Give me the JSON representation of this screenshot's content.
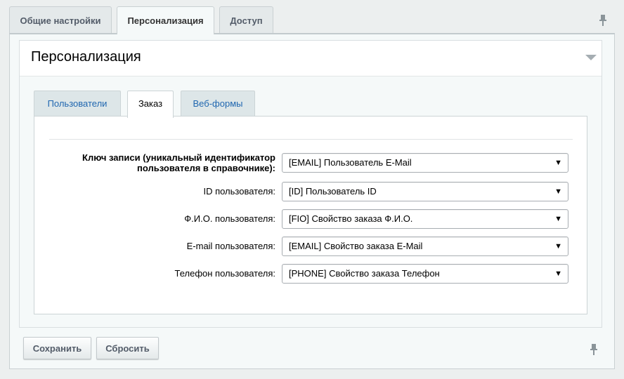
{
  "top_tabs": [
    {
      "label": "Общие настройки",
      "active": false
    },
    {
      "label": "Персонализация",
      "active": true
    },
    {
      "label": "Доступ",
      "active": false
    }
  ],
  "section": {
    "title": "Персонализация"
  },
  "inner_tabs": [
    {
      "label": "Пользователи",
      "active": false
    },
    {
      "label": "Заказ",
      "active": true
    },
    {
      "label": "Веб-формы",
      "active": false
    }
  ],
  "fields": [
    {
      "label": "Ключ записи (уникальный идентификатор пользователя в справочнике):",
      "value": "[EMAIL] Пользователь E-Mail"
    },
    {
      "label": "ID пользователя:",
      "value": "[ID] Пользователь ID"
    },
    {
      "label": "Ф.И.О. пользователя:",
      "value": "[FIO] Свойство заказа Ф.И.О."
    },
    {
      "label": "E-mail пользователя:",
      "value": "[EMAIL] Свойство заказа E-Mail"
    },
    {
      "label": "Телефон пользователя:",
      "value": "[PHONE] Свойство заказа Телефон"
    }
  ],
  "buttons": {
    "save_label": "Сохранить",
    "reset_label": "Сбросить"
  },
  "colors": {
    "page_bg": "#ecefef",
    "link_tab": "#2067b0",
    "button_text": "#535c69"
  }
}
